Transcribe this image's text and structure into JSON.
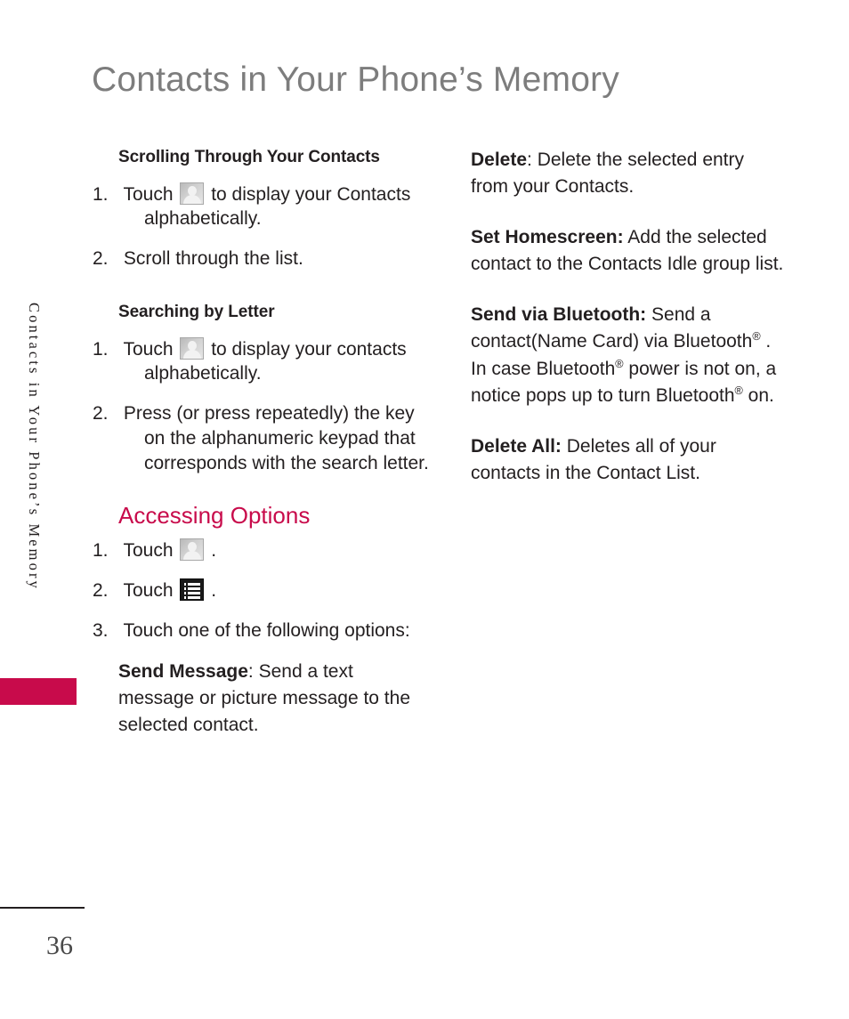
{
  "page": {
    "title": "Contacts in Your Phone’s Memory",
    "side_tab_label": "Contacts in Your Phone’s Memory",
    "page_number": "36",
    "accent_color": "#c80b4b",
    "title_color": "#7d7d7d",
    "body_color": "#231f20"
  },
  "left_column": {
    "subhead_scrolling": "Scrolling Through Your Contacts",
    "steps_scrolling": [
      {
        "num": "1.",
        "text_before": "Touch",
        "icon": "contact-icon",
        "text_after": "to display your Contacts alphabetically."
      },
      {
        "num": "2.",
        "text_before": "Scroll through the list.",
        "icon": "",
        "text_after": ""
      }
    ],
    "subhead_searching": "Searching by Letter",
    "steps_searching": [
      {
        "num": "1.",
        "text_before": "Touch",
        "icon": "contact-icon",
        "text_after": "to display your contacts alphabetically."
      },
      {
        "num": "2.",
        "text_before": "Press (or press repeatedly) the key on the alphanumeric keypad that corresponds with the search letter.",
        "icon": "",
        "text_after": ""
      }
    ],
    "section_head_accessing": "Accessing Options",
    "steps_accessing": [
      {
        "num": "1.",
        "text_before": "Touch",
        "icon": "contact-icon",
        "text_after": "."
      },
      {
        "num": "2.",
        "text_before": "Touch",
        "icon": "menu-icon",
        "text_after": "."
      },
      {
        "num": "3.",
        "text_before": "Touch one of the following options:",
        "icon": "",
        "text_after": ""
      }
    ],
    "option_send_message_term": "Send Message",
    "option_send_message_body": ": Send a text message or picture message to the selected contact."
  },
  "right_column": {
    "option_delete_term": "Delete",
    "option_delete_body": ": Delete the selected entry from your Contacts.",
    "option_set_homescreen_term": "Set Homescreen:",
    "option_set_homescreen_body": " Add the selected contact to the Contacts Idle group list.",
    "option_send_bluetooth_term": "Send via Bluetooth:",
    "option_send_bluetooth_body_1": " Send a contact(Name Card) via Bluetooth",
    "option_send_bluetooth_reg_1": "®",
    "option_send_bluetooth_body_2": " . In case Bluetooth",
    "option_send_bluetooth_reg_2": "®",
    "option_send_bluetooth_body_3": " power is not on, a notice pops up to turn Bluetooth",
    "option_send_bluetooth_reg_3": "®",
    "option_send_bluetooth_body_4": " on.",
    "option_delete_all_term": "Delete All:",
    "option_delete_all_body": " Deletes all of your contacts in the Contact List."
  }
}
